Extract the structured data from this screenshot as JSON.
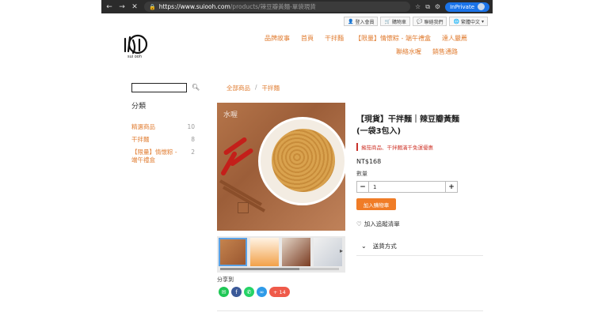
{
  "browser": {
    "url_host": "https://www.suiooh.com",
    "url_path": "/products/辣豆瓣黃麵-單袋現貨",
    "inprivate_label": "InPrivate"
  },
  "topbar": {
    "login": "登入會員",
    "cart": "購物車",
    "contact": "聯絡我們",
    "lang": "繁體中文"
  },
  "logo": {
    "sub": "sui ooh"
  },
  "mainnav": {
    "row1": [
      "品牌故事",
      "首頁",
      "干拌麵",
      "【限量】情懷粽 - 端午禮盒",
      "達人嚴薦"
    ],
    "row2": [
      "聯絡水喔",
      "銷售通路"
    ]
  },
  "sidebar": {
    "search_placeholder": "",
    "categories_title": "分類",
    "categories": [
      {
        "name": "精選商品",
        "count": "10"
      },
      {
        "name": "干拌麵",
        "count": "8"
      },
      {
        "name": "【限量】情懷粽 - 端午禮盒",
        "count": "2"
      }
    ]
  },
  "breadcrumb": {
    "home": "全部商品",
    "sep": "/",
    "current": "干拌麵"
  },
  "product": {
    "title": "【現貨】干拌麵｜辣豆瓣黃麵 (一袋3包入)",
    "promo": "擁茄商品、干拌麵滿千免運優惠",
    "price": "NT$168",
    "qty_label": "數量",
    "qty_value": "1",
    "qty_minus": "−",
    "qty_plus": "+",
    "cart_label": "加入購物車",
    "wish_label": "加入追蹤清單",
    "shipping_label": "送貨方式"
  },
  "share": {
    "label": "分享到",
    "count": "+ 14"
  },
  "colors": {
    "accent": "#e07b2f",
    "button": "#f07c27",
    "promo": "#d03a2f"
  }
}
